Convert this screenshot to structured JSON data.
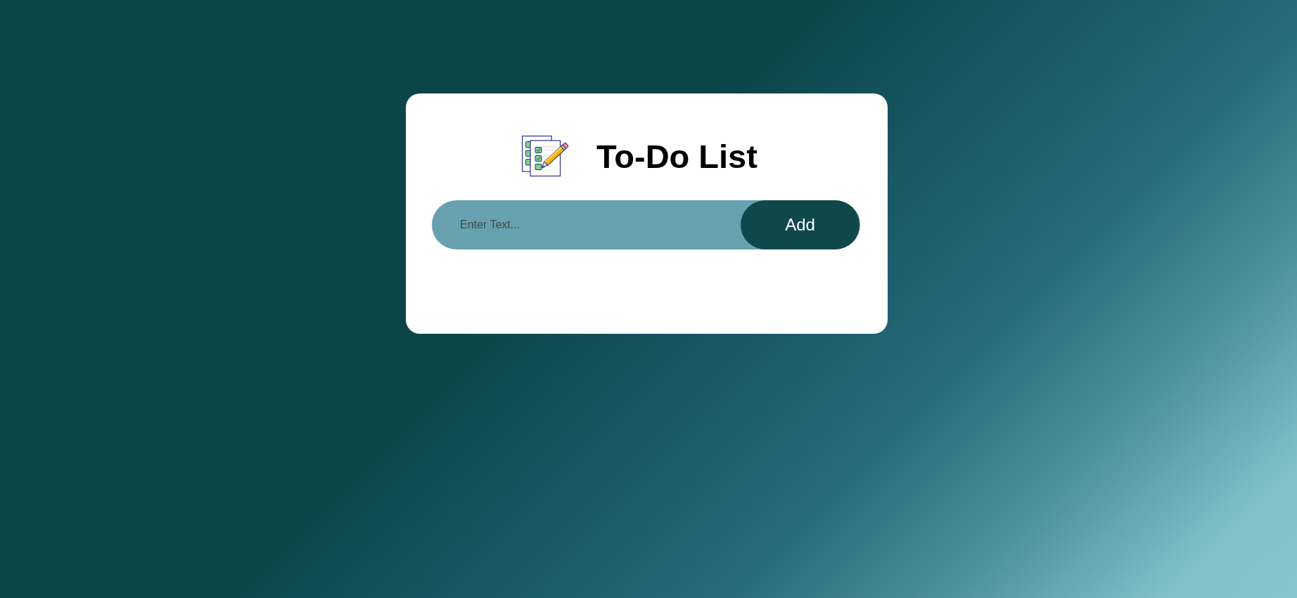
{
  "card": {
    "title": "To-Do List",
    "input": {
      "placeholder": "Enter Text..."
    },
    "add_button": {
      "label": "Add"
    }
  }
}
